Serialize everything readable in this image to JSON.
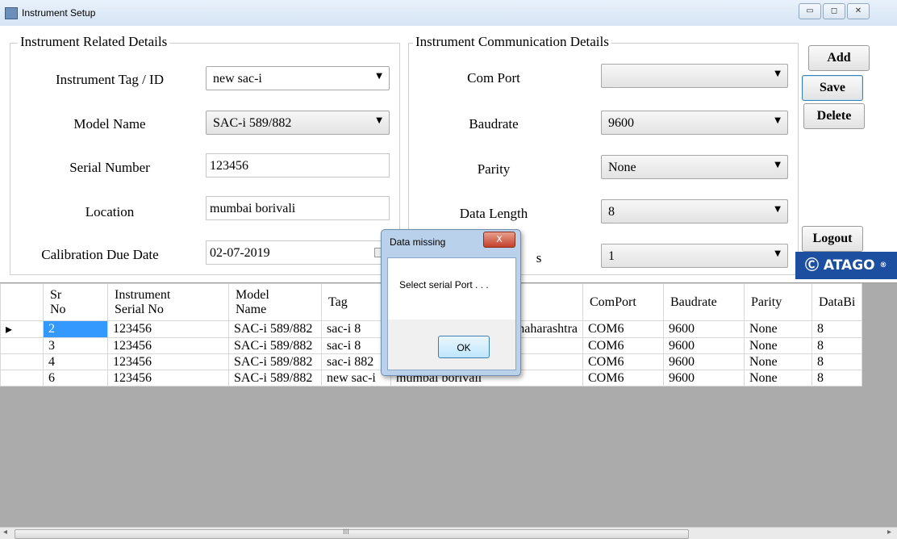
{
  "window": {
    "title": "Instrument Setup",
    "buttons": [
      "▭",
      "◻",
      "✕"
    ]
  },
  "instrument_group": {
    "legend": "Instrument Related Details",
    "tag_label": "Instrument Tag / ID",
    "tag_value": "new sac-i",
    "model_label": "Model Name",
    "model_value": "SAC-i 589/882",
    "serial_label": "Serial Number",
    "serial_value": "123456",
    "location_label": "Location",
    "location_value": "mumbai borivali",
    "cal_label": "Calibration Due Date",
    "cal_value": "02-07-2019"
  },
  "comm_group": {
    "legend": "Instrument Communication Details",
    "comport_label": "Com Port",
    "comport_value": "",
    "baud_label": "Baudrate",
    "baud_value": "9600",
    "parity_label": "Parity",
    "parity_value": "None",
    "datalen_label": "Data Length",
    "datalen_value": "8",
    "stopbits_label_visible": "s",
    "stopbits_value": "1"
  },
  "actions": {
    "add": "Add",
    "save": "Save",
    "delete": "Delete",
    "logout": "Logout"
  },
  "logo": {
    "text": "ATAGO",
    "mark": "Ⓒ",
    "reg": "®"
  },
  "table": {
    "columns": [
      "Sr\nNo",
      "Instrument\nSerial No",
      "Model\nName",
      "Tag",
      "",
      "ComPort",
      "Baudrate",
      "Parity",
      "DataBi"
    ],
    "rows": [
      {
        "marker": "▸",
        "sr": "2",
        "serial": "123456",
        "model": "SAC-i 589/882",
        "tag": "sac-i 8",
        "location": "haharashtra",
        "comport": "COM6",
        "baud": "9600",
        "parity": "None",
        "databits": "8"
      },
      {
        "marker": "",
        "sr": "3",
        "serial": "123456",
        "model": "SAC-i 589/882",
        "tag": "sac-i 8",
        "location": "",
        "comport": "COM6",
        "baud": "9600",
        "parity": "None",
        "databits": "8"
      },
      {
        "marker": "",
        "sr": "4",
        "serial": "123456",
        "model": "SAC-i 589/882",
        "tag": "sac-i 882",
        "location": "mumbai borivali",
        "comport": "COM6",
        "baud": "9600",
        "parity": "None",
        "databits": "8"
      },
      {
        "marker": "",
        "sr": "6",
        "serial": "123456",
        "model": "SAC-i 589/882",
        "tag": "new sac-i",
        "location": "mumbai borivali",
        "comport": "COM6",
        "baud": "9600",
        "parity": "None",
        "databits": "8"
      }
    ]
  },
  "scrollbar": {
    "left_arrow": "◂",
    "right_arrow": "▸",
    "grip": "III"
  },
  "dialog": {
    "title": "Data missing",
    "close": "X",
    "message": "Select serial Port . . .",
    "ok": "OK"
  }
}
